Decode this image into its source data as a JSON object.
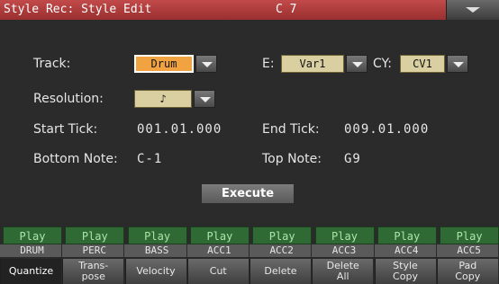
{
  "title": "Style Rec: Style Edit",
  "chord": "C 7",
  "track": {
    "label": "Track:",
    "value": "Drum"
  },
  "element": {
    "label": "E:",
    "value": "Var1"
  },
  "cv": {
    "label": "CY:",
    "value": "CV1"
  },
  "resolution": {
    "label": "Resolution:",
    "value": "♪"
  },
  "start_tick": {
    "label": "Start Tick:",
    "value": "001.01.000"
  },
  "end_tick": {
    "label": "End Tick:",
    "value": "009.01.000"
  },
  "bottom_note": {
    "label": "Bottom Note:",
    "value": "C-1"
  },
  "top_note": {
    "label": "Top Note:",
    "value": "G9"
  },
  "execute_label": "Execute",
  "tracks": [
    {
      "status": "Play",
      "name": "DRUM"
    },
    {
      "status": "Play",
      "name": "PERC"
    },
    {
      "status": "Play",
      "name": "BASS"
    },
    {
      "status": "Play",
      "name": "ACC1"
    },
    {
      "status": "Play",
      "name": "ACC2"
    },
    {
      "status": "Play",
      "name": "ACC3"
    },
    {
      "status": "Play",
      "name": "ACC4"
    },
    {
      "status": "Play",
      "name": "ACC5"
    }
  ],
  "tabs": [
    {
      "label": "Quantize"
    },
    {
      "label": "Trans-\npose"
    },
    {
      "label": "Velocity"
    },
    {
      "label": "Cut"
    },
    {
      "label": "Delete"
    },
    {
      "label": "Delete\nAll"
    },
    {
      "label": "Style\nCopy"
    },
    {
      "label": "Pad\nCopy"
    }
  ]
}
